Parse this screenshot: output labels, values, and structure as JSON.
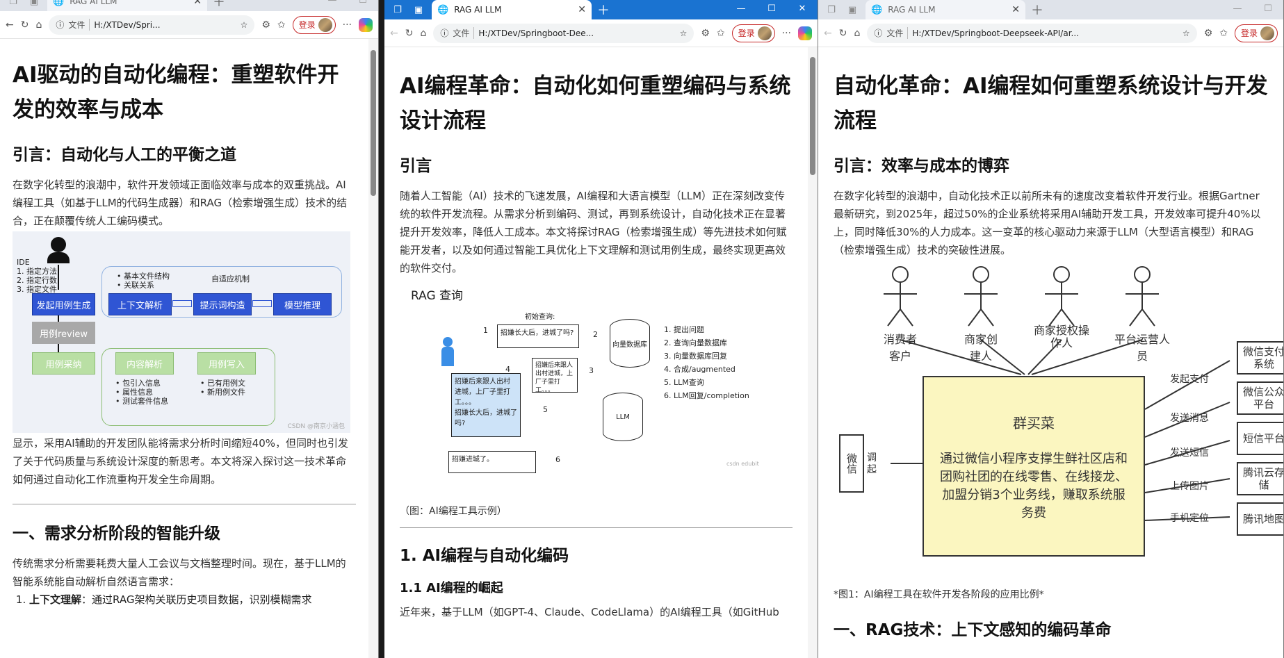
{
  "browser": {
    "tab_title": "RAG AI LLM",
    "file_label": "文件",
    "login_label": "登录",
    "w1_url": "H:/XTDev/Spri...",
    "w2_url": "H:/XTDev/Springboot-Dee...",
    "w3_url": "H:/XTDev/Springboot-Deepseek-API/ar..."
  },
  "w1": {
    "h1": "AI驱动的自动化编程：重塑软件开发的效率与成本",
    "h2_intro": "引言：自动化与人工的平衡之道",
    "p_intro": "在数字化转型的浪潮中，软件开发领域正面临效率与成本的双重挑战。AI编程工具（如基于LLM的代码生成器）和RAG（检索增强生成）技术的结合，正在颠覆传统人工编码模式。",
    "fig": {
      "ide": "IDE",
      "ide_items": [
        "1. 指定方法",
        "2. 指定行数",
        "3. 指定文件"
      ],
      "start": "发起用例生成",
      "review": "用例review",
      "adopt": "用例采纳",
      "basic": "基本文件结构",
      "relation": "关联关系",
      "adaptive": "自适应机制",
      "ctx": "上下文解析",
      "prompt": "提示词构造",
      "infer": "模型推理",
      "content": "内容解析",
      "write": "用例写入",
      "c_items": [
        "包引入信息",
        "属性信息",
        "测试套件信息"
      ],
      "w_items": [
        "已有用例文",
        "新用例文件"
      ],
      "watermark": "CSDN @南京小涵包"
    },
    "p_after": "显示，采用AI辅助的开发团队能将需求分析时间缩短40%，但同时也引发了关于代码质量与系统设计深度的新思考。本文将深入探讨这一技术革命如何通过自动化工作流重构开发全生命周期。",
    "h2_one": "一、需求分析阶段的智能升级",
    "p_one": "传统需求分析需要耗费大量人工会议与文档整理时间。现在，基于LLM的智能系统能自动解析自然语言需求：",
    "li_bold": "上下文理解",
    "li_text": "：通过RAG架构关联历史项目数据，识别模糊需求"
  },
  "w2": {
    "h1": "AI编程革命：自动化如何重塑编码与系统设计流程",
    "h2_intro": "引言",
    "p_intro": "随着人工智能（AI）技术的飞速发展，AI编程和大语言模型（LLM）正在深刻改变传统的软件开发流程。从需求分析到编码、测试，再到系统设计，自动化技术正在显著提升开发效率，降低人工成本。本文将探讨RAG（检索增强生成）等先进技术如何赋能开发者，以及如何通过智能工具优化上下文理解和测试用例生成，最终实现更高效的软件交付。",
    "fig": {
      "title": "RAG 查询",
      "initial": "初始查询:",
      "q1": "招嫌长大后，进城了吗?",
      "vdb": "向量数据库",
      "ctx_small": "招嫌后来跟人出村进城，上厂子里打工。。。",
      "merged_a": "招嫌后来跟人出村",
      "merged_b": "进城，上厂子里打",
      "merged_c": "工。。。",
      "merged_q": "招嫌长大后，进城了吗?",
      "llm": "LLM",
      "answer": "招嫌进城了。",
      "steps": [
        "1. 提出问题",
        "2. 查询向量数据库",
        "3. 向量数据库回复",
        "4. 合成/augmented",
        "5. LLM查询",
        "6. LLM回复/completion"
      ],
      "nums": [
        "1",
        "2",
        "3",
        "4",
        "5",
        "6"
      ],
      "watermark": "csdn edubit"
    },
    "caption": "（图：AI编程工具示例）",
    "h2_one": "1. AI编程与自动化编码",
    "h3_one": "1.1 AI编程的崛起",
    "p_one": "近年来，基于LLM（如GPT-4、Claude、CodeLlama）的AI编程工具（如GitHub"
  },
  "w3": {
    "h1": "自动化革命：AI编程如何重塑系统设计与开发流程",
    "h2_intro": "引言：效率与成本的博弈",
    "p_intro": "在数字化转型的浪潮中，自动化技术正以前所未有的速度改变着软件开发行业。根据Gartner最新研究，到2025年，超过50%的企业系统将采用AI辅助开发工具，开发效率可提升40%以上，同时降低30%的人力成本。这一变革的核心驱动力来源于LLM（大型语言模型）和RAG（检索增强生成）技术的突破性进展。",
    "fig": {
      "actors": [
        "消费者客户",
        "商家创建人",
        "商家授权操作人",
        "平台运营人员"
      ],
      "center_title": "群买菜",
      "center_desc": "通过微信小程序支撑生鲜社区店和团购社团的在线零售、在线接龙、加盟分销3个业务线，赚取系统服务费",
      "wechat": "微信",
      "invoke": "调起",
      "right_boxes": [
        "微信支付系统",
        "微信公众平台",
        "短信平台",
        "腾讯云存储",
        "腾讯地图"
      ],
      "right_labels": [
        "发起支付",
        "发送消息",
        "发送短信",
        "上传图片",
        "手机定位"
      ]
    },
    "caption": "*图1：AI编程工具在软件开发各阶段的应用比例*",
    "h2_one": "一、RAG技术：上下文感知的编码革命"
  }
}
